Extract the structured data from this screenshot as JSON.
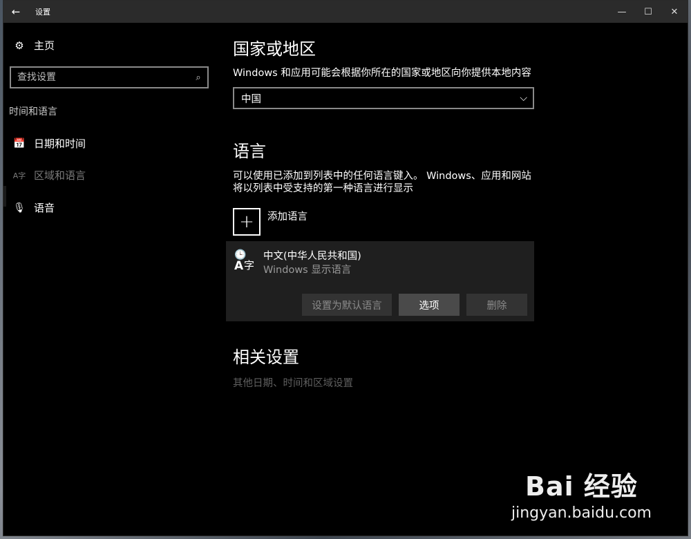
{
  "window": {
    "title": "设置",
    "back_icon": "←",
    "minimize": "—",
    "maximize": "☐",
    "close": "✕"
  },
  "sidebar": {
    "home_label": "主页",
    "search_placeholder": "查找设置",
    "section_label": "时间和语言",
    "items": [
      {
        "label": "日期和时间",
        "icon": "calendar-clock-icon"
      },
      {
        "label": "区域和语言",
        "icon": "region-language-icon"
      },
      {
        "label": "语音",
        "icon": "microphone-icon"
      }
    ]
  },
  "content": {
    "region": {
      "heading": "国家或地区",
      "description": "Windows 和应用可能会根据你所在的国家或地区向你提供本地内容",
      "selected_value": "中国"
    },
    "language": {
      "heading": "语言",
      "description_line1": "可以使用已添加到列表中的任何语言键入。 Windows、应用和网站",
      "description_line2": "将以列表中受支持的第一种语言进行显示",
      "add_label": "添加语言",
      "entry": {
        "name": "中文(中华人民共和国)",
        "subtitle": "Windows 显示语言"
      },
      "buttons": {
        "set_default": "设置为默认语言",
        "options": "选项",
        "remove": "删除"
      }
    },
    "related": {
      "heading": "相关设置",
      "link": "其他日期、时间和区域设置"
    }
  },
  "watermark": {
    "main": "Bai 经验",
    "sub": "jingyan.baidu.com"
  }
}
